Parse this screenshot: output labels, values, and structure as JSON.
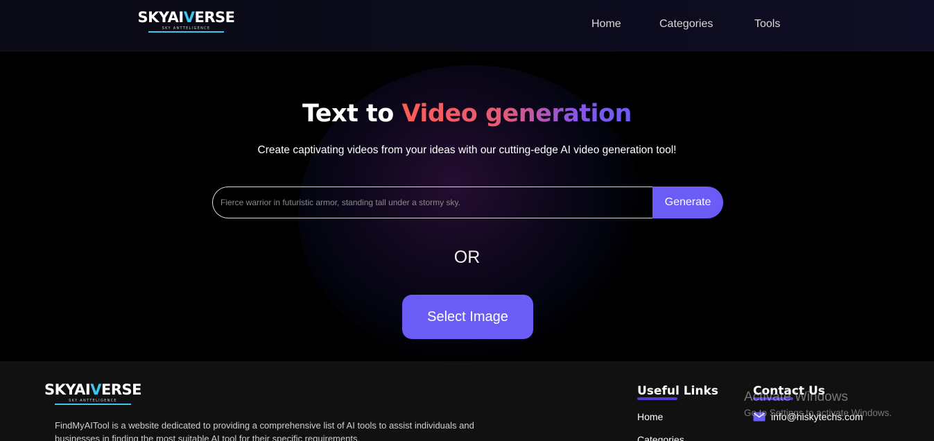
{
  "header": {
    "logo": {
      "part1": "SKYAI",
      "part2": "V",
      "part3": "ERSE",
      "tagline": "SKY ANTTELIGENCE"
    },
    "nav": [
      {
        "label": "Home"
      },
      {
        "label": "Categories"
      },
      {
        "label": "Tools"
      }
    ]
  },
  "hero": {
    "title_white": "Text to ",
    "title_gradient": "Video generation",
    "subtitle": "Create captivating videos from your ideas with our cutting-edge AI video generation tool!",
    "search": {
      "value": "",
      "placeholder": "Fierce warrior in futuristic armor, standing tall under a stormy sky."
    },
    "generate_label": "Generate",
    "or_label": "OR",
    "select_image_label": "Select Image"
  },
  "footer": {
    "logo": {
      "part1": "SKYAI",
      "part2": "V",
      "part3": "ERSE",
      "tagline": "SKY ANTTELIGENCE"
    },
    "description": "FindMyAITool is a website dedicated to providing a comprehensive list of AI tools to assist individuals and businesses in finding the most suitable AI tool for their specific requirements.",
    "useful_links": {
      "heading": "Useful Links",
      "items": [
        {
          "label": "Home"
        },
        {
          "label": "Categories"
        }
      ]
    },
    "contact": {
      "heading": "Contact Us",
      "email": "info@hiskytechs.com"
    }
  },
  "watermark": {
    "line1": "Activate Windows",
    "line2": "Go to Settings to activate Windows."
  },
  "colors": {
    "accent": "#6a5cf5",
    "logo_cyan": "#3fc4ee",
    "gradient_start": "#ff5c52",
    "gradient_end": "#6a5cf5"
  },
  "icons": [
    "mail-icon"
  ]
}
